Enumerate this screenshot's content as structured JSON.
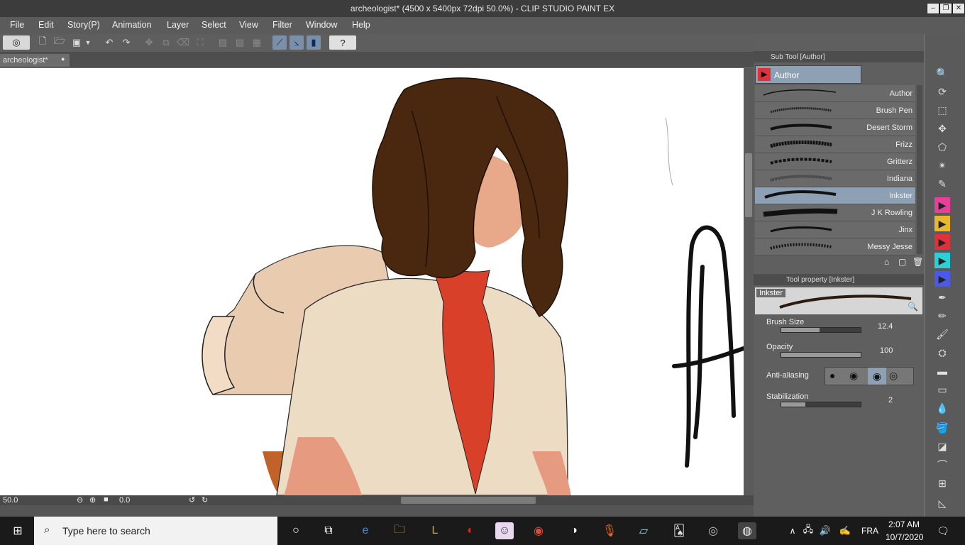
{
  "window": {
    "title": "archeologist* (4500 x 5400px 72dpi 50.0%) - CLIP STUDIO PAINT EX"
  },
  "menu": [
    "File",
    "Edit",
    "Story(P)",
    "Animation",
    "Layer",
    "Select",
    "View",
    "Filter",
    "Window",
    "Help"
  ],
  "document_tab": {
    "label": "archeologist*"
  },
  "subtool_panel": {
    "header": "Sub Tool [Author]",
    "group": "Author",
    "brushes": [
      "Author",
      "Brush Pen",
      "Desert Storm",
      "Frizz",
      "Gritterz",
      "Indiana",
      "Inkster",
      "J K Rowling",
      "Jinx",
      "Messy Jesse"
    ],
    "selected_index": 6
  },
  "tool_property": {
    "header": "Tool property [Inkster]",
    "preset": "Inkster",
    "brush_size": {
      "label": "Brush Size",
      "value": "12.4",
      "fill_pct": 48
    },
    "opacity": {
      "label": "Opacity",
      "value": "100",
      "fill_pct": 100
    },
    "anti_aliasing": {
      "label": "Anti-aliasing",
      "selected_index": 2
    },
    "stabilization": {
      "label": "Stabilization",
      "value": "2",
      "fill_pct": 30
    }
  },
  "status": {
    "zoom": "50.0",
    "rotation": "0.0"
  },
  "taskbar": {
    "search_placeholder": "Type here to search",
    "language": "FRA",
    "time": "2:07 AM",
    "date": "10/7/2020"
  },
  "colors": {
    "accent_select": "#8da0b4",
    "tie_red": "#d8402a",
    "hair_brown": "#4a2810"
  }
}
